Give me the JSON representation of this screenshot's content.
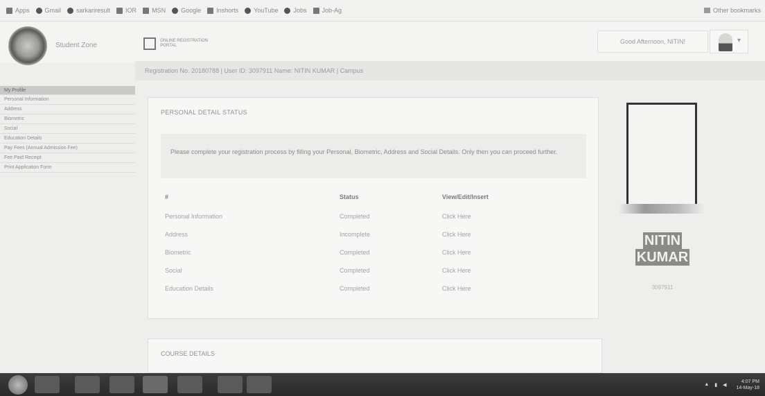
{
  "bookmarks": [
    "Apps",
    "Gmail",
    "sarkariresult",
    "IOR",
    "MSN",
    "Google",
    "Inshorts",
    "YouTube",
    "Jobs",
    "Job-Ag"
  ],
  "bookmarks_right": "Other bookmarks",
  "brand": "Student Zone",
  "portal_logo_text": "ONLINE REGISTRATION PORTAL",
  "welcome": "Good Afternoon, NITIN!",
  "registration_bar": "Registration No. 20180788 | User ID: 3097911 Name: NITIN KUMAR | Campus",
  "sidebar": {
    "items": [
      "My Profile",
      "Personal Information",
      "Address",
      "Biometric",
      "Social",
      "Education Details",
      "Pay Fees (Annual Admission Fee)",
      "Fee Paid Receipt",
      "Print Application Form"
    ]
  },
  "panel": {
    "title": "PERSONAL DETAIL STATUS",
    "notice": "Please complete your registration process by filling your Personal, Biometric, Address and Social Details. Only then you can proceed further.",
    "headers": [
      "#",
      "Status",
      "View/Edit/Insert"
    ],
    "rows": [
      {
        "label": "Personal Information",
        "status": "Completed",
        "action": "Click Here"
      },
      {
        "label": "Address",
        "status": "Incomplete",
        "action": "Click Here"
      },
      {
        "label": "Biometric",
        "status": "Completed",
        "action": "Click Here"
      },
      {
        "label": "Social",
        "status": "Completed",
        "action": "Click Here"
      },
      {
        "label": "Education Details",
        "status": "Completed",
        "action": "Click Here"
      }
    ]
  },
  "course": {
    "title": "COURSE DETAILS"
  },
  "profile": {
    "first": "NITIN",
    "last": "KUMAR",
    "reg": "3097911"
  },
  "tray": {
    "time": "4:07 PM",
    "date": "14-May-18"
  }
}
